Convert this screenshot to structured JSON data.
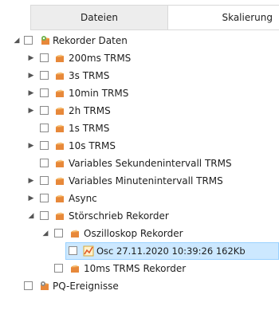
{
  "tabs": {
    "files": "Dateien",
    "scaling": "Skalierung"
  },
  "tree": {
    "root": "Rekorder Daten",
    "items": [
      "200ms TRMS",
      "3s TRMS",
      "10min TRMS",
      "2h TRMS",
      "1s TRMS",
      "10s TRMS",
      "Variables Sekundenintervall TRMS",
      "Variables Minutenintervall TRMS",
      "Async",
      "Störschrieb Rekorder"
    ],
    "osc_group": "Oszilloskop Rekorder",
    "osc_file": "Osc 27.11.2020 10:39:26 162Kb",
    "rec10ms": "10ms TRMS Rekorder",
    "pq_events": "PQ-Ereignisse"
  }
}
